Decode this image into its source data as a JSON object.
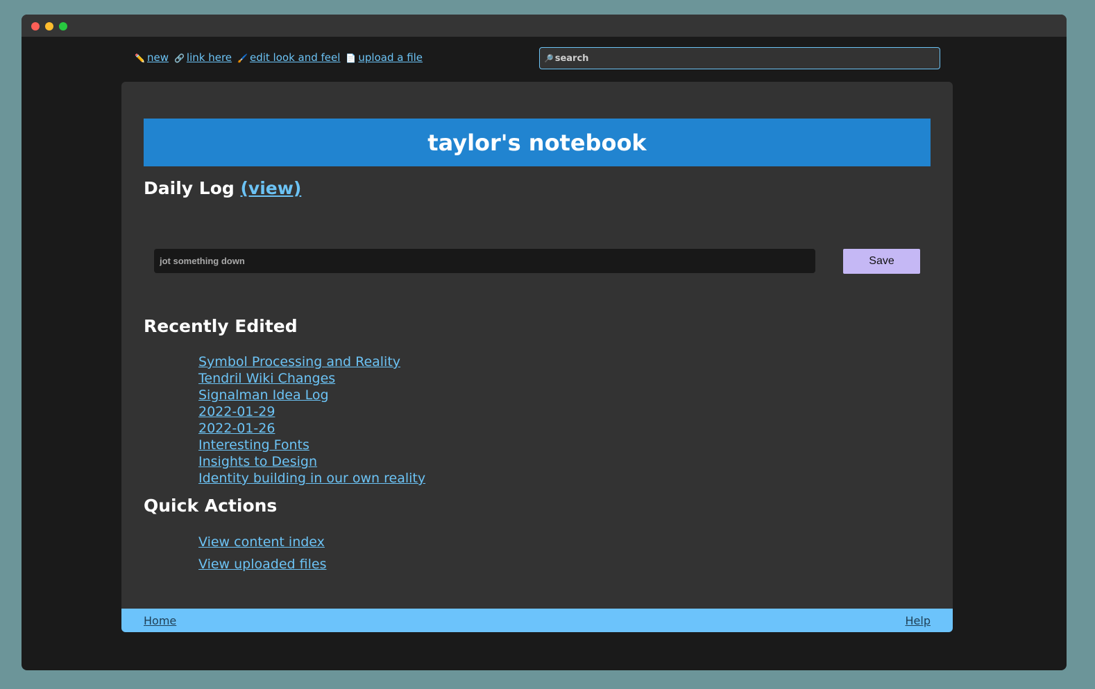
{
  "nav": {
    "new": {
      "icon": "✏️",
      "label": "new"
    },
    "link": {
      "icon": "🔗",
      "label": "link here"
    },
    "edit": {
      "icon": "🖌️",
      "label": "edit look and feel"
    },
    "upload": {
      "icon": "📄",
      "label": "upload a file"
    }
  },
  "search": {
    "icon": "🔎",
    "placeholder": "search"
  },
  "title": "taylor's notebook",
  "daily_log": {
    "heading": "Daily Log",
    "view_label": "(view)"
  },
  "jot": {
    "placeholder": "jot something down",
    "save_label": "Save"
  },
  "recent": {
    "heading": "Recently Edited",
    "items": [
      "Symbol Processing and Reality",
      "Tendril Wiki Changes",
      "Signalman Idea Log",
      "2022-01-29",
      "2022-01-26",
      "Interesting Fonts",
      "Insights to Design",
      "Identity building in our own reality"
    ]
  },
  "quick": {
    "heading": "Quick Actions",
    "items": [
      "View content index",
      "View uploaded files"
    ]
  },
  "footer": {
    "home": "Home",
    "help": "Help"
  },
  "colors": {
    "accent_link": "#6cc3f5",
    "banner": "#2184d0",
    "save_button": "#c5b8f5",
    "footer": "#6cc3fb"
  }
}
